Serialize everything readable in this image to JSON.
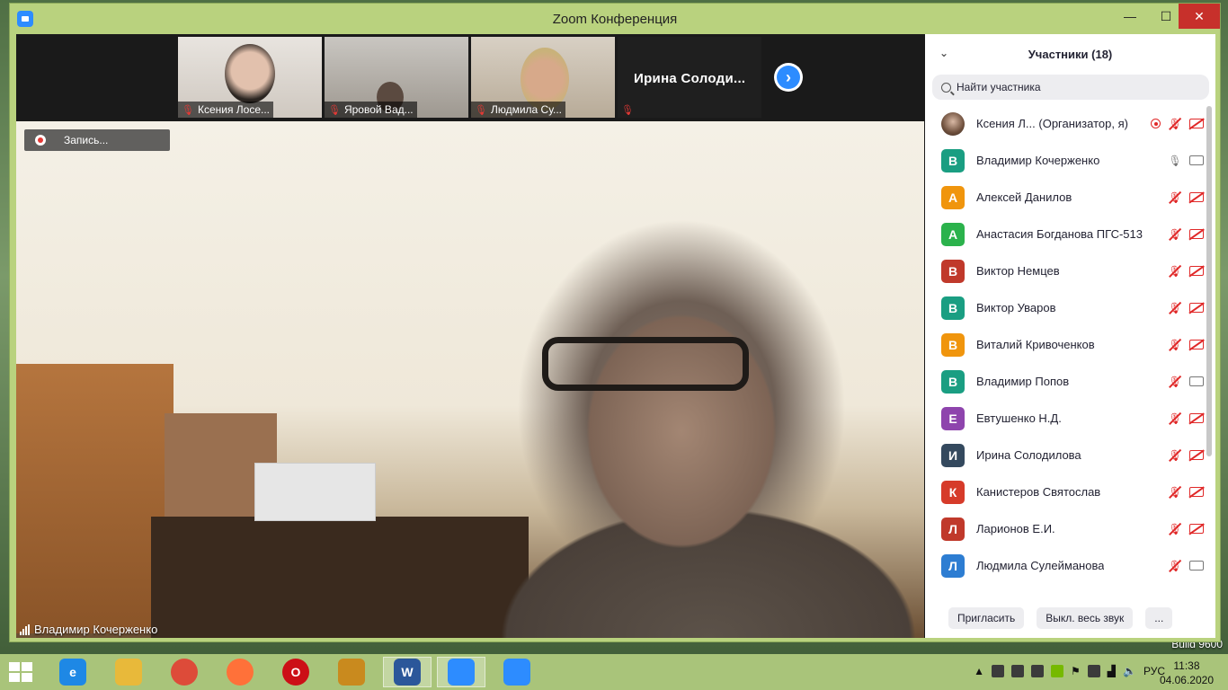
{
  "window": {
    "title": "Zoom Конференция",
    "min": "—",
    "max": "☐",
    "close": "✕"
  },
  "thumbnails": [
    {
      "name": "Ксения Лосе..."
    },
    {
      "name": "Яровой Вад..."
    },
    {
      "name": "Людмила Су..."
    },
    {
      "name": "Ирина  Солоди...",
      "label": ""
    }
  ],
  "recording": {
    "label": "Запись..."
  },
  "speaker": {
    "name": "Владимир Кочерженко"
  },
  "panel": {
    "title": "Участники (18)",
    "search_placeholder": "Найти участника",
    "participants": [
      {
        "initial": "",
        "name": "Ксения Л...  (Организатор, я)",
        "color": "",
        "photo": true,
        "mic": "muted",
        "cam": "off",
        "rec": true
      },
      {
        "initial": "В",
        "name": "Владимир Кочерженко",
        "color": "#1a9e82",
        "mic": "on",
        "cam": "on"
      },
      {
        "initial": "А",
        "name": "Алексей Данилов",
        "color": "#f0950d",
        "mic": "muted",
        "cam": "off"
      },
      {
        "initial": "А",
        "name": "Анастасия Богданова ПГС-513",
        "color": "#2bb24c",
        "mic": "muted",
        "cam": "off"
      },
      {
        "initial": "В",
        "name": "Виктор Немцев",
        "color": "#c0392b",
        "mic": "muted",
        "cam": "off"
      },
      {
        "initial": "В",
        "name": "Виктор Уваров",
        "color": "#1a9e82",
        "mic": "muted",
        "cam": "off"
      },
      {
        "initial": "В",
        "name": "Виталий Кривоченков",
        "color": "#f0950d",
        "mic": "muted",
        "cam": "off"
      },
      {
        "initial": "В",
        "name": "Владимир Попов",
        "color": "#1a9e82",
        "mic": "muted",
        "cam": "on"
      },
      {
        "initial": "Е",
        "name": "Евтушенко Н.Д.",
        "color": "#8e44ad",
        "mic": "muted",
        "cam": "off"
      },
      {
        "initial": "И",
        "name": "Ирина Солодилова",
        "color": "#34495e",
        "mic": "muted",
        "cam": "off"
      },
      {
        "initial": "К",
        "name": "Канистеров Святослав",
        "color": "#d63b2a",
        "mic": "muted",
        "cam": "off"
      },
      {
        "initial": "Л",
        "name": "Ларионов Е.И.",
        "color": "#c0392b",
        "mic": "muted",
        "cam": "off"
      },
      {
        "initial": "Л",
        "name": "Людмила Сулейманова",
        "color": "#2d7dd2",
        "mic": "muted",
        "cam": "on"
      }
    ],
    "invite_label": "Пригласить",
    "mute_all_label": "Выкл. весь звук",
    "more_label": "..."
  },
  "taskbar": {
    "apps": [
      {
        "name": "ie-icon",
        "glyph": "e",
        "color": "#1e88e5"
      },
      {
        "name": "explorer-icon",
        "glyph": "",
        "color": "#e8b93a"
      },
      {
        "name": "chrome-icon",
        "glyph": "",
        "color": "#dd4b39"
      },
      {
        "name": "firefox-icon",
        "glyph": "",
        "color": "#ff7139"
      },
      {
        "name": "opera-icon",
        "glyph": "O",
        "color": "#cc0f16"
      },
      {
        "name": "notes-icon",
        "glyph": "",
        "color": "#c98a1e"
      },
      {
        "name": "word-icon",
        "glyph": "W",
        "color": "#2b579a"
      },
      {
        "name": "zoom-icon",
        "glyph": "",
        "color": "#2d8cff"
      },
      {
        "name": "zoom-icon-2",
        "glyph": "",
        "color": "#2d8cff"
      }
    ],
    "lang": "РУС",
    "time": "11:38",
    "date": "04.06.2020"
  },
  "desktop": {
    "build": "Build 9600"
  }
}
